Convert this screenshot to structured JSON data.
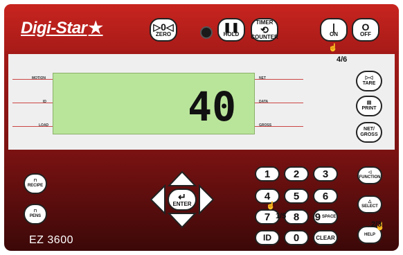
{
  "brand": {
    "logo_text": "Digi-Star",
    "logo_mark": "★"
  },
  "top_buttons": {
    "zero": "ZERO",
    "hold": "HOLD",
    "timer_line1": "TIMER",
    "timer_line2": "COUNTER",
    "on": "ON",
    "off": "OFF"
  },
  "display": {
    "value": "40",
    "indicators_left": [
      "MOTION",
      "ID",
      "LOAD"
    ],
    "indicators_right": [
      "NET",
      "DATA",
      "GROSS"
    ]
  },
  "right_buttons": {
    "tare": "TARE",
    "print": "PRINT",
    "net_gross_1": "NET/",
    "net_gross_2": "GROSS"
  },
  "left_buttons": {
    "recipe": "RECIPE",
    "pens": "PENS"
  },
  "nav": {
    "enter": "ENTER"
  },
  "keypad": {
    "k1": "1",
    "k2": "2",
    "k3": "3",
    "k4": "4",
    "k5": "5",
    "k6": "6",
    "k7": "7",
    "k8": "8",
    "k9": "9",
    "k0": "0",
    "space": "SPACE",
    "id": "ID",
    "clear": "CLEAR"
  },
  "side_keys": {
    "function": "FUNCTION",
    "select": "SELECT",
    "help": "HELP"
  },
  "model": "EZ 3600",
  "hints": {
    "top": "4/6",
    "middle": "1/5",
    "right": "2/3"
  },
  "colors": {
    "panel": "#b81e1c",
    "lcd": "#b9e59a"
  }
}
